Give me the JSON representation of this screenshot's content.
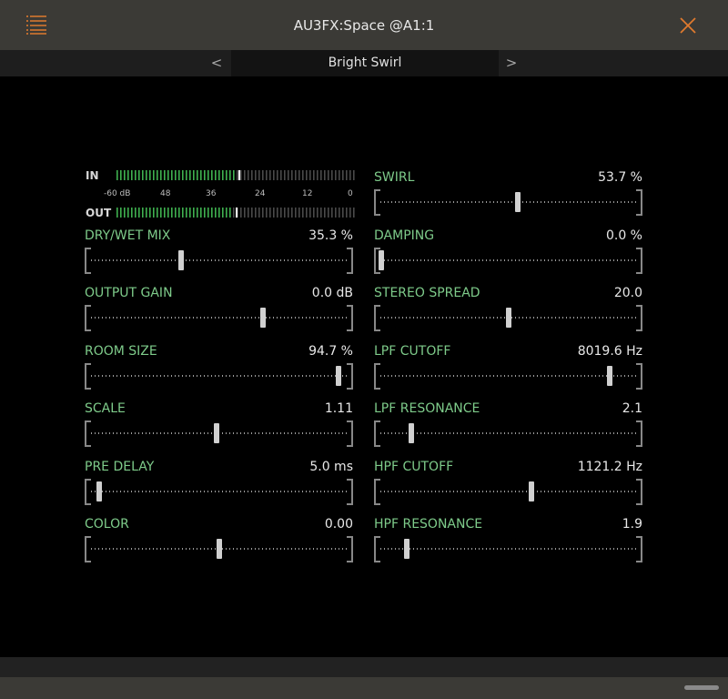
{
  "window": {
    "title": "AU3FX:Space @A1:1"
  },
  "header": {
    "menu_icon": "hamburger-list-icon",
    "close_icon": "close-x-icon",
    "accent_color": "#e07a2e"
  },
  "preset": {
    "name": "Bright Swirl",
    "prev_label": "<",
    "next_label": ">"
  },
  "meter": {
    "in_label": "IN",
    "out_label": "OUT",
    "scale": [
      "-60 dB",
      "48",
      "36",
      "24",
      "12",
      "0"
    ],
    "in_level": 0.5,
    "in_peak": 0.51,
    "out_level": 0.47,
    "out_peak": 0.5,
    "segment_color": "#3fb04f"
  },
  "params_left": [
    {
      "name": "DRY/WET MIX",
      "value": "35.3 %",
      "pos": 0.353
    },
    {
      "name": "OUTPUT GAIN",
      "value": "0.0 dB",
      "pos": 0.675
    },
    {
      "name": "ROOM SIZE",
      "value": "94.7 %",
      "pos": 0.97
    },
    {
      "name": "SCALE",
      "value": "1.11",
      "pos": 0.49
    },
    {
      "name": "PRE DELAY",
      "value": "5.0 ms",
      "pos": 0.03
    },
    {
      "name": "COLOR",
      "value": "0.00",
      "pos": 0.5
    }
  ],
  "params_right": [
    {
      "name": "SWIRL",
      "value": "53.7 %",
      "pos": 0.537
    },
    {
      "name": "DAMPING",
      "value": "0.0 %",
      "pos": 0.0
    },
    {
      "name": "STEREO SPREAD",
      "value": "20.0",
      "pos": 0.5
    },
    {
      "name": "LPF CUTOFF",
      "value": "8019.6 Hz",
      "pos": 0.9
    },
    {
      "name": "LPF RESONANCE",
      "value": "2.1",
      "pos": 0.12
    },
    {
      "name": "HPF CUTOFF",
      "value": "1121.2 Hz",
      "pos": 0.59
    },
    {
      "name": "HPF RESONANCE",
      "value": "1.9",
      "pos": 0.1
    }
  ]
}
